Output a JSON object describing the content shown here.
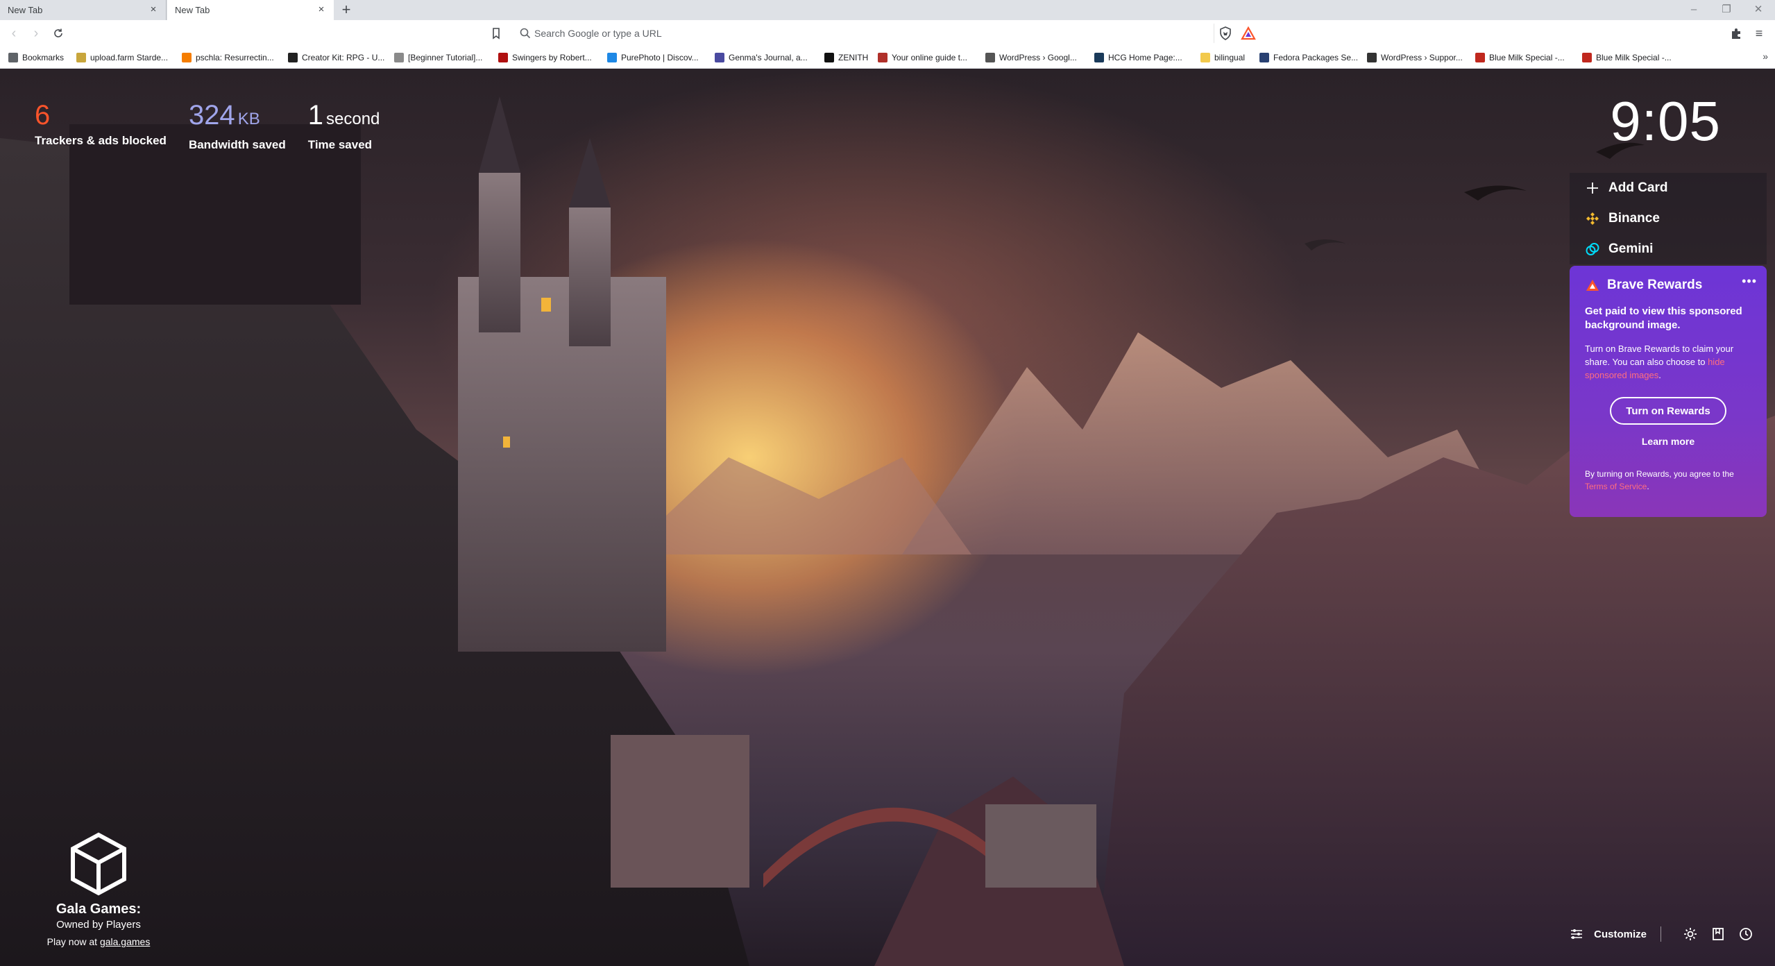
{
  "browser": {
    "tabs": [
      {
        "title": "New Tab",
        "active": false
      },
      {
        "title": "New Tab",
        "active": true
      }
    ],
    "omnibox": {
      "placeholder": "Search Google or type a URL"
    },
    "bookmarks": [
      {
        "label": "Bookmarks",
        "icon": "bookmarks-icon",
        "color": "#5f6368"
      },
      {
        "label": "upload.farm Starde...",
        "icon": "upload-farm-icon",
        "color": "#c8a63c"
      },
      {
        "label": "pschla: Resurrectin...",
        "icon": "blogger-icon",
        "color": "#f57d00"
      },
      {
        "label": "Creator Kit: RPG - U...",
        "icon": "unity-icon",
        "color": "#222222"
      },
      {
        "label": "[Beginner Tutorial]...",
        "icon": "forum-icon",
        "color": "#8a8a8a"
      },
      {
        "label": "Swingers by Robert...",
        "icon": "tumblr-icon",
        "color": "#b01010"
      },
      {
        "label": "PurePhoto | Discov...",
        "icon": "purephoto-icon",
        "color": "#1e88e5"
      },
      {
        "label": "Genma's Journal, a...",
        "icon": "journal-icon",
        "color": "#4a4aa0"
      },
      {
        "label": "ZENITH",
        "icon": "zenith-icon",
        "color": "#111111"
      },
      {
        "label": "Your online guide t...",
        "icon": "guide-icon",
        "color": "#b0302a"
      },
      {
        "label": "WordPress › Googl...",
        "icon": "wordpress-icon",
        "color": "#555555"
      },
      {
        "label": "HCG Home Page:...",
        "icon": "hcg-icon",
        "color": "#1a3a5a"
      },
      {
        "label": "bilingual",
        "icon": "folder-icon",
        "color": "#f2c94c"
      },
      {
        "label": "Fedora Packages Se...",
        "icon": "fedora-icon",
        "color": "#294172"
      },
      {
        "label": "WordPress › Suppor...",
        "icon": "wordpress-support-icon",
        "color": "#333333"
      },
      {
        "label": "Blue Milk Special -...",
        "icon": "bluemilk-icon",
        "color": "#c0281e"
      },
      {
        "label": "Blue Milk Special -...",
        "icon": "bluemilk-icon",
        "color": "#c0281e"
      }
    ]
  },
  "stats": {
    "trackers": {
      "value": "6",
      "label": "Trackers & ads blocked"
    },
    "bandwidth": {
      "value": "324",
      "unit": "KB",
      "label": "Bandwidth saved"
    },
    "time": {
      "value": "1",
      "unit": "second",
      "label": "Time saved"
    }
  },
  "clock": "9:05",
  "cards": {
    "add_card": "Add Card",
    "binance": "Binance",
    "gemini": "Gemini"
  },
  "rewards": {
    "title": "Brave Rewards",
    "headline": "Get paid to view this sponsored background image.",
    "body_prefix": "Turn on Brave Rewards to claim your share. You can also choose to ",
    "body_link": "hide sponsored images",
    "body_suffix": ".",
    "turn_on_button": "Turn on Rewards",
    "learn_more": "Learn more",
    "terms_prefix": "By turning on Rewards, you agree to the ",
    "terms_link": "Terms of Service",
    "terms_suffix": "."
  },
  "sponsor": {
    "name": "Gala Games:",
    "tagline": "Owned by Players",
    "cta_prefix": "Play now at ",
    "cta_link": "gala.games"
  },
  "bottom": {
    "customize": "Customize"
  },
  "colors": {
    "trackers_accent": "#fb542b",
    "bandwidth_accent": "#a0a5eb",
    "rewards_purple": "#6d35d6",
    "binance_yellow": "#f3ba2f",
    "gemini_cyan": "#00dcfa",
    "brave_orange": "#fb542b"
  }
}
